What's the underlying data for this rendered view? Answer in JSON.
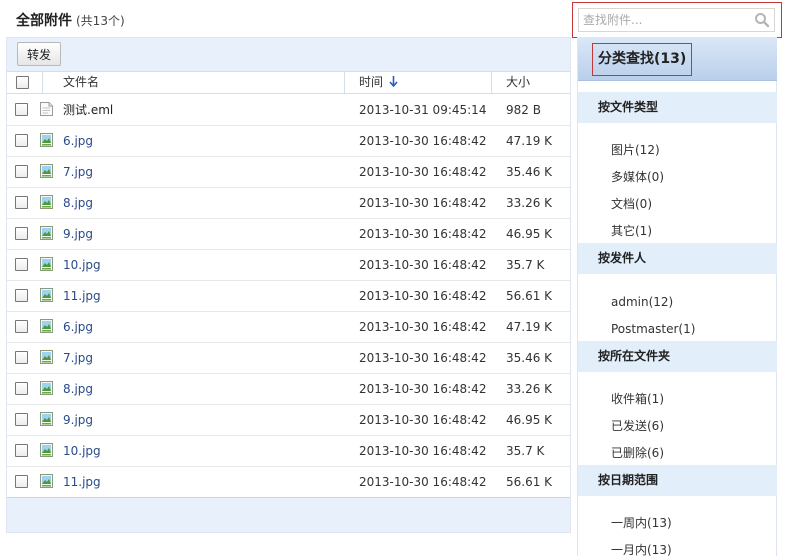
{
  "header": {
    "title": "全部附件",
    "count": "(共13个)"
  },
  "search": {
    "placeholder": "查找附件..."
  },
  "toolbar": {
    "forward_label": "转发"
  },
  "table": {
    "columns": {
      "name": "文件名",
      "time": "时间",
      "size": "大小"
    },
    "rows": [
      {
        "name": "测试.eml",
        "time": "2013-10-31 09:45:14",
        "size": "982 B",
        "type": "document"
      },
      {
        "name": "6.jpg",
        "time": "2013-10-30 16:48:42",
        "size": "47.19 K",
        "type": "image"
      },
      {
        "name": "7.jpg",
        "time": "2013-10-30 16:48:42",
        "size": "35.46 K",
        "type": "image"
      },
      {
        "name": "8.jpg",
        "time": "2013-10-30 16:48:42",
        "size": "33.26 K",
        "type": "image"
      },
      {
        "name": "9.jpg",
        "time": "2013-10-30 16:48:42",
        "size": "46.95 K",
        "type": "image"
      },
      {
        "name": "10.jpg",
        "time": "2013-10-30 16:48:42",
        "size": "35.7 K",
        "type": "image"
      },
      {
        "name": "11.jpg",
        "time": "2013-10-30 16:48:42",
        "size": "56.61 K",
        "type": "image"
      },
      {
        "name": "6.jpg",
        "time": "2013-10-30 16:48:42",
        "size": "47.19 K",
        "type": "image"
      },
      {
        "name": "7.jpg",
        "time": "2013-10-30 16:48:42",
        "size": "35.46 K",
        "type": "image"
      },
      {
        "name": "8.jpg",
        "time": "2013-10-30 16:48:42",
        "size": "33.26 K",
        "type": "image"
      },
      {
        "name": "9.jpg",
        "time": "2013-10-30 16:48:42",
        "size": "46.95 K",
        "type": "image"
      },
      {
        "name": "10.jpg",
        "time": "2013-10-30 16:48:42",
        "size": "35.7 K",
        "type": "image"
      },
      {
        "name": "11.jpg",
        "time": "2013-10-30 16:48:42",
        "size": "56.61 K",
        "type": "image"
      }
    ]
  },
  "sidebar": {
    "title": "分类查找(13)",
    "groups": [
      {
        "title": "按文件类型",
        "items": [
          "图片(12)",
          "多媒体(0)",
          "文档(0)",
          "其它(1)"
        ]
      },
      {
        "title": "按发件人",
        "items": [
          "admin(12)",
          "Postmaster(1)"
        ]
      },
      {
        "title": "按所在文件夹",
        "items": [
          "收件箱(1)",
          "已发送(6)",
          "已删除(6)"
        ]
      },
      {
        "title": "按日期范围",
        "items": [
          "一周内(13)",
          "一月内(13)"
        ]
      }
    ]
  },
  "colors": {
    "accent_border": "#c6373a",
    "panel_bg": "#e8f0fb",
    "link": "#2a4a8a",
    "sort_arrow": "#2b5fb5"
  },
  "icons": {
    "search": "magnifier-icon",
    "sort": "arrow-down-icon",
    "image_file": "image-file-icon",
    "document_file": "document-file-icon"
  }
}
